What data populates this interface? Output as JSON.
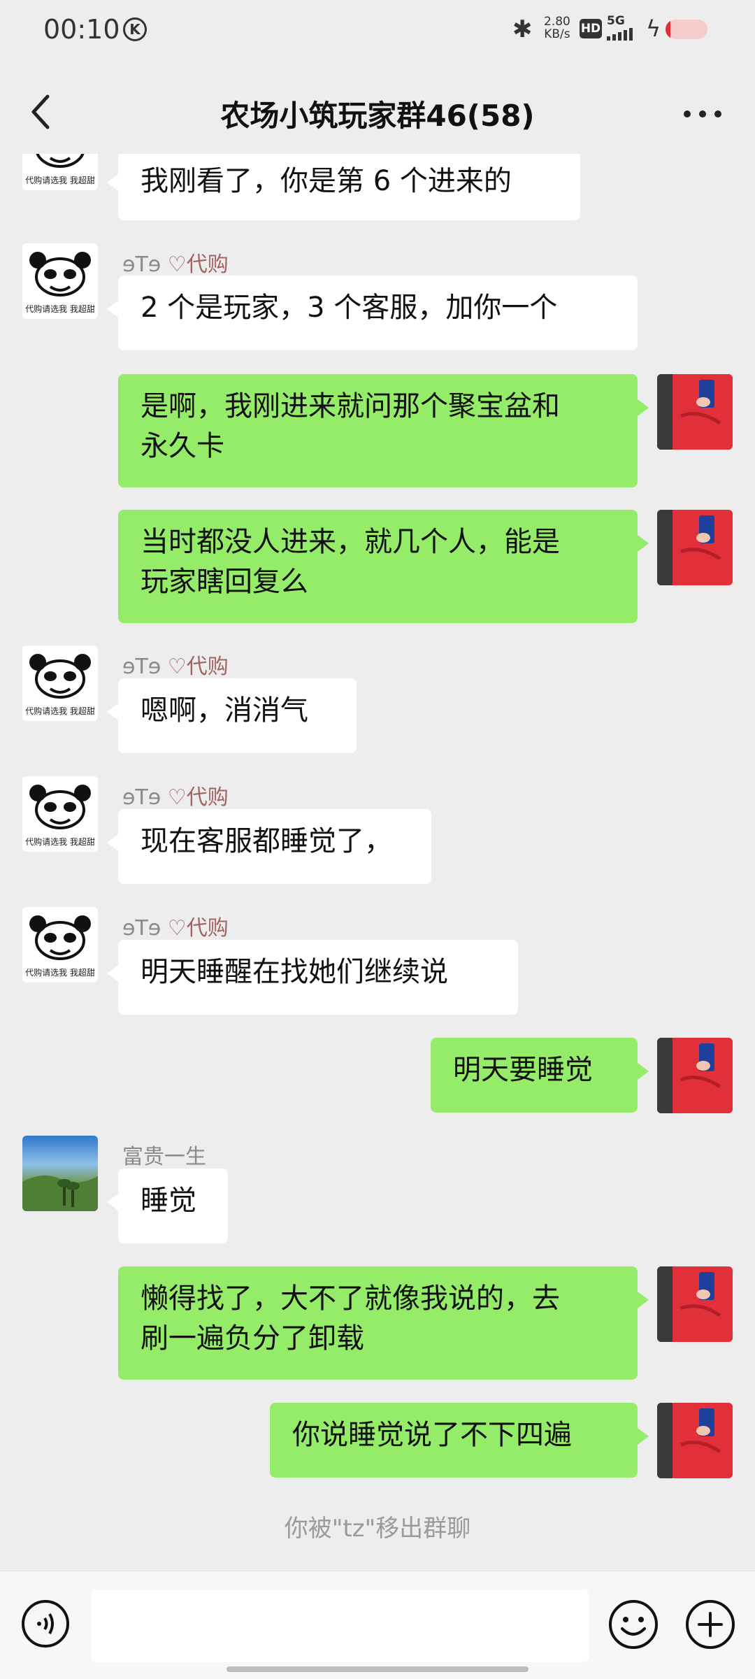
{
  "status_bar": {
    "time": "00:10",
    "k_icon": "K",
    "net_speed_value": "2.80",
    "net_speed_unit": "KB/s",
    "hd": "HD",
    "network": "5G",
    "battery_level": 0.12,
    "battery_color": "#d9303a"
  },
  "header": {
    "title": "农场小筑玩家群46(58)",
    "back_icon": "chevron-left-icon",
    "more_icon": "more-icon"
  },
  "sender_names": {
    "a": "ɘTɘ",
    "a_tag": "代购",
    "b": "富贵一生"
  },
  "panda_caption": "代购请选我 我超甜",
  "messages": [
    {
      "from": "other",
      "text": "我刚看了，你是第 6 个进来的"
    },
    {
      "from": "other",
      "text": "2 个是玩家，3 个客服，加你一个"
    },
    {
      "from": "self",
      "text": "是啊，我刚进来就问那个聚宝盆和\n永久卡"
    },
    {
      "from": "self",
      "text": "当时都没人进来，就几个人，能是\n玩家瞎回复么"
    },
    {
      "from": "other",
      "text": "嗯啊，消消气"
    },
    {
      "from": "other",
      "text": "现在客服都睡觉了，"
    },
    {
      "from": "other",
      "text": "明天睡醒在找她们继续说"
    },
    {
      "from": "self",
      "text": "明天要睡觉"
    },
    {
      "from": "other",
      "text": "睡觉"
    },
    {
      "from": "self",
      "text": "懒得找了，大不了就像我说的，去\n刷一遍负分了卸载"
    },
    {
      "from": "self",
      "text": "你说睡觉说了不下四遍"
    }
  ],
  "system_message": "你被\"tz\"移出群聊",
  "input_bar": {
    "voice_icon": "voice-icon",
    "emoji_icon": "emoji-icon",
    "plus_icon": "plus-icon",
    "value": ""
  },
  "colors": {
    "background": "#ededed",
    "bubble_self": "#95ec69",
    "bubble_other": "#ffffff"
  }
}
